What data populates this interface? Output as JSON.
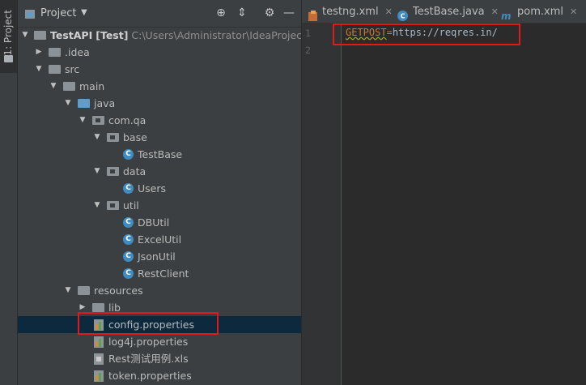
{
  "sidebar": {
    "tab_label": "1: Project"
  },
  "panel": {
    "title": "Project",
    "caret": "▼",
    "buttons": {
      "locate": "⊕",
      "collapse": "⇕",
      "settings": "⚙",
      "hide": "—"
    }
  },
  "tree": {
    "root": {
      "name": "TestAPI",
      "module": "[Test]",
      "path": "C:\\Users\\Administrator\\IdeaProjects\\T"
    },
    "idea": ".idea",
    "src": "src",
    "main": "main",
    "java": "java",
    "com_qa": "com.qa",
    "base": "base",
    "testbase": "TestBase",
    "data": "data",
    "users": "Users",
    "util": "util",
    "dbutil": "DBUtil",
    "excelutil": "ExcelUtil",
    "jsonutil": "JsonUtil",
    "restclient": "RestClient",
    "resources": "resources",
    "lib": "lib",
    "config": "config.properties",
    "log4j": "log4j.properties",
    "xls": "Rest测试用例.xls",
    "token": "token.properties"
  },
  "editor_tabs": [
    {
      "label": "testng.xml"
    },
    {
      "label": "TestBase.java"
    },
    {
      "label": "pom.xml"
    }
  ],
  "editor": {
    "line_numbers": [
      "1",
      "2"
    ],
    "line1": {
      "key": "GETPOST",
      "eq": "=",
      "value": "https://reqres.in/"
    }
  },
  "colors": {
    "background": "#2b2b2b",
    "panel": "#3c3f41",
    "selection": "#0d293e",
    "highlight_box": "#e0191a"
  }
}
